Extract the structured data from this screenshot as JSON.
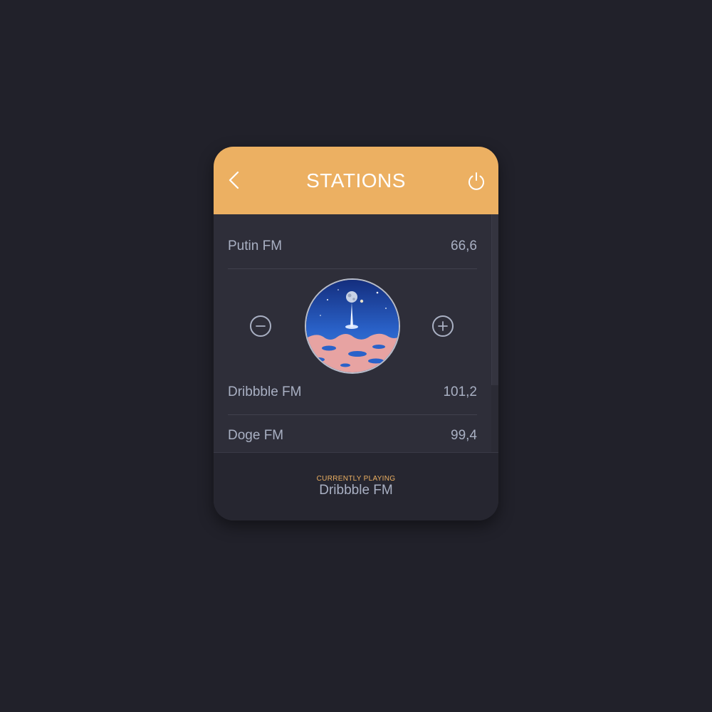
{
  "header": {
    "title": "STATIONS",
    "back_icon": "chevron-left-icon",
    "power_icon": "power-icon"
  },
  "stations": [
    {
      "name": "Putin FM",
      "freq": "66,6"
    },
    {
      "name": "Dribbble FM",
      "freq": "101,2"
    },
    {
      "name": "Doge FM",
      "freq": "99,4"
    }
  ],
  "player": {
    "minus_icon": "minus-circle-icon",
    "plus_icon": "plus-circle-icon",
    "art": "album-art"
  },
  "footer": {
    "label": "CURRENTLY PLAYING",
    "station": "Dribbble FM"
  },
  "colors": {
    "accent": "#ecb062",
    "background": "#21212a",
    "panel": "#2e2e39",
    "footer": "#262630",
    "text": "#a9b0c3"
  }
}
